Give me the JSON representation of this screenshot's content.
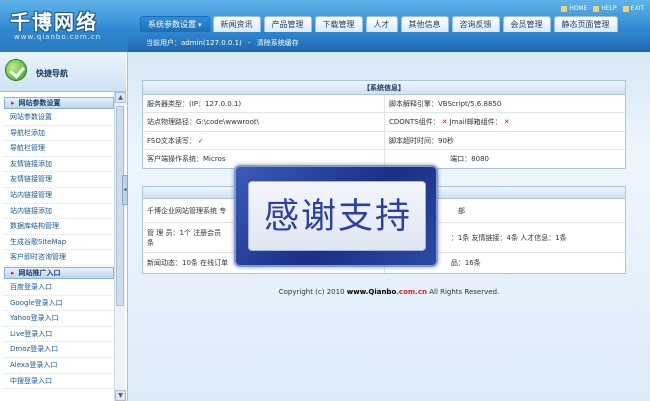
{
  "header": {
    "logo_title": "千博网络",
    "logo_sub": "www.qianbo.com.cn",
    "top_links": [
      "HOME",
      "HELP",
      "EXIT"
    ],
    "tabs": [
      "系统参数设置",
      "新闻资讯",
      "产品管理",
      "下载管理",
      "人才",
      "其他信息",
      "咨询反馈",
      "会员管理",
      "静态页面管理"
    ],
    "subbar_user": "当前用户：admin(127.0.0.1)",
    "subbar_clear": "清除系统缓存"
  },
  "sidebar": {
    "quick_nav": "快捷导航",
    "section1": "网站参数设置",
    "section1_items": [
      "网站参数设置",
      "导航栏添加",
      "导航栏管理",
      "友情链接添加",
      "友情链接管理",
      "站内链接管理",
      "站内链接添加",
      "数据库结构管理",
      "生成谷歌SiteMap",
      "客户即时咨询管理"
    ],
    "section2": "网站推广入口",
    "section2_items": [
      "百度登录入口",
      "Google登录入口",
      "Yahoo登录入口",
      "Live登录入口",
      "Dmoz登录入口",
      "Alexa登录入口",
      "中搜登录入口"
    ]
  },
  "system_info": {
    "title": "【系统信息】",
    "server_type": "服务器类型：(IP：127.0.0.1)",
    "script_engine": "脚本解释引擎：VBScript/5.6.8850",
    "site_path": "站点物理路径：G:\\code\\wwwroot\\",
    "cdonts_prefix": "CDONTS组件：",
    "jmail": "Jmail邮箱组件：",
    "fso_prefix": "FSO文本读写：",
    "script_timeout": "脚本超时时间：90秒",
    "client_os": "客户端操作系统：Micros",
    "port": "端口：8080",
    "cross": "✕",
    "check": "✓"
  },
  "stats": {
    "line1_left": "千博企业网站管理系统 专",
    "line1_right": "部",
    "line2_left": "管 理 员：1个 注册会员",
    "line2_right": "：1条 友情链接：4条 人才信息：1条",
    "line2_wrap": "条",
    "line3_left": "新闻动态：10条 在线订单",
    "line3_right": "品：16条"
  },
  "copyright": {
    "prefix": "Copyright (c) 2010",
    "site": "www.Qianbo",
    "cn": ".com.cn",
    "suffix": "All Rights Reserved."
  },
  "overlay": {
    "text": "感谢支持"
  }
}
